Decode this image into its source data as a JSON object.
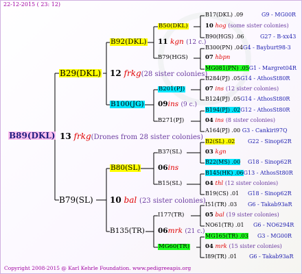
{
  "header": "22-12-2015 ( 23: 12)",
  "footer": "Copyright 2008-2015 @ Karl Kehrle Foundation.   www.pedigreeapis.org",
  "root": {
    "label": "B89(DKL)",
    "num": "13",
    "drone": "frkg",
    "note": "(Drones from 28 sister colonies)"
  },
  "g1": [
    {
      "label": "B29(DKL)",
      "num": "12",
      "drone": "frkg",
      "note": "(28 sister colonies)"
    },
    {
      "label": "B79(SL)",
      "num": "10",
      "drone": "bal",
      "note": "(23 sister colonies)"
    }
  ],
  "g2": [
    {
      "label": "B92(DKL)",
      "num": "11",
      "drone": "kgn",
      "note": "(12 c.)"
    },
    {
      "label": "B100(JG)",
      "num": "09",
      "drone": "ins",
      "note": "(9 c.)"
    },
    {
      "label": "B80(SL)",
      "num": "06",
      "drone": "ins",
      "note": ""
    },
    {
      "label": "B135(TR)",
      "num": "06",
      "drone": "mrk",
      "note": "(21 c.)"
    }
  ],
  "g3": [
    {
      "label": "B50(DKL)",
      "num": "10",
      "drone": "hog",
      "note": "(some sister colonies)"
    },
    {
      "label": "B79(HGS)",
      "num": "07",
      "drone": "hbpn",
      "note": ""
    },
    {
      "label": "B201(PJ)",
      "num": "07",
      "drone": "ins",
      "note": "(12 sister colonies)"
    },
    {
      "label": "B271(PJ)",
      "num": "04",
      "drone": "ins",
      "note": "(8 sister colonies)"
    },
    {
      "label": "B37(SL)",
      "num": "03",
      "drone": "kgn",
      "note": ""
    },
    {
      "label": "B15(SL)",
      "num": "04",
      "drone": "thl",
      "note": "(12 sister colonies)"
    },
    {
      "label": "I177(TR)",
      "num": "05",
      "drone": "bal",
      "note": "(19 sister colonies)"
    },
    {
      "label": "MG60(TR)",
      "num": "04",
      "drone": "mrk",
      "note": "(15 sister colonies)"
    }
  ],
  "g4": [
    {
      "label": "B17(DKL) .09",
      "ref": "G9 - MG00R"
    },
    {
      "label": "B90(HGS) .06",
      "ref": "G27 - B-xx43"
    },
    {
      "label": "B300(PN) .04",
      "ref": "G4 - Bayburt98-3"
    },
    {
      "label": "MG081(PN) .05",
      "ref": "G1 - Margret04R"
    },
    {
      "label": "B284(PJ) .05",
      "ref": "G14 - AthosSt80R"
    },
    {
      "label": "B124(PJ) .05",
      "ref": "G14 - AthosSt80R"
    },
    {
      "label": "B194(PJ) .02",
      "ref": "G12 - AthosSt80R"
    },
    {
      "label": "A164(PJ) .00",
      "ref": "G3 - Cankiri97Q"
    },
    {
      "label": "B2(SL) .02",
      "ref": "G22 - Sinop62R"
    },
    {
      "label": "B22(MS) .00",
      "ref": "G18 - Sinop62R"
    },
    {
      "label": "B145(HK) .06",
      "ref": "G13 - AthosSt80R"
    },
    {
      "label": "B19(CS) .01",
      "ref": "G18 - Sinop62R"
    },
    {
      "label": "I51(TR) .03",
      "ref": "G6 - Takab93aR"
    },
    {
      "label": "NO61(TR) .01",
      "ref": "G6 - NO6294R"
    },
    {
      "label": "MG165(TR) .03",
      "ref": "G3 - MG00R"
    },
    {
      "label": "I89(TR) .01",
      "ref": "G6 - Takab93aR"
    }
  ]
}
